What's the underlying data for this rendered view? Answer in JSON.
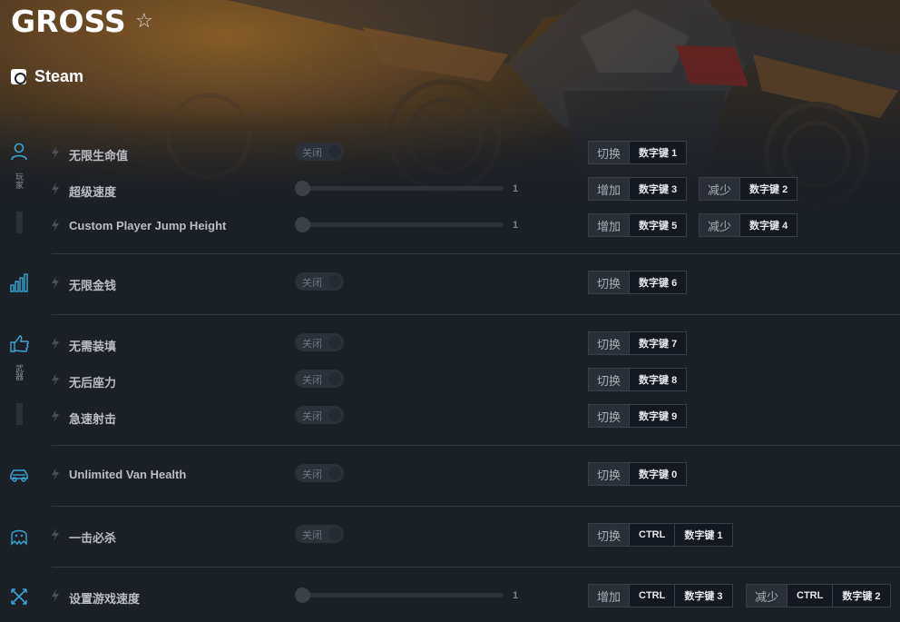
{
  "game": {
    "title": "GROSS",
    "platform": "Steam"
  },
  "categories": [
    {
      "name": "player",
      "label": "玩家"
    },
    {
      "name": "stats",
      "label": ""
    },
    {
      "name": "weapons",
      "label": "武器"
    },
    {
      "name": "vehicle",
      "label": ""
    },
    {
      "name": "enemy",
      "label": ""
    },
    {
      "name": "game",
      "label": ""
    }
  ],
  "options": [
    {
      "name": "无限生命值",
      "control": "toggle",
      "state": "关闭",
      "hotkeys": [
        {
          "action": "切换",
          "keys": [
            "数字键 1"
          ]
        }
      ]
    },
    {
      "name": "超级速度",
      "control": "slider",
      "value": "1",
      "hotkeys": [
        {
          "action": "增加",
          "keys": [
            "数字键 3"
          ]
        },
        {
          "action": "减少",
          "keys": [
            "数字键 2"
          ]
        }
      ]
    },
    {
      "name": "Custom Player Jump Height",
      "control": "slider",
      "value": "1",
      "hotkeys": [
        {
          "action": "增加",
          "keys": [
            "数字键 5"
          ]
        },
        {
          "action": "减少",
          "keys": [
            "数字键 4"
          ]
        }
      ]
    },
    {
      "name": "无限金钱",
      "control": "toggle",
      "state": "关闭",
      "hotkeys": [
        {
          "action": "切换",
          "keys": [
            "数字键 6"
          ]
        }
      ]
    },
    {
      "name": "无需装填",
      "control": "toggle",
      "state": "关闭",
      "hotkeys": [
        {
          "action": "切换",
          "keys": [
            "数字键 7"
          ]
        }
      ]
    },
    {
      "name": "无后座力",
      "control": "toggle",
      "state": "关闭",
      "hotkeys": [
        {
          "action": "切换",
          "keys": [
            "数字键 8"
          ]
        }
      ]
    },
    {
      "name": "急速射击",
      "control": "toggle",
      "state": "关闭",
      "hotkeys": [
        {
          "action": "切换",
          "keys": [
            "数字键 9"
          ]
        }
      ]
    },
    {
      "name": "Unlimited Van Health",
      "control": "toggle",
      "state": "关闭",
      "hotkeys": [
        {
          "action": "切换",
          "keys": [
            "数字键 0"
          ]
        }
      ]
    },
    {
      "name": "一击必杀",
      "control": "toggle",
      "state": "关闭",
      "hotkeys": [
        {
          "action": "切换",
          "keys": [
            "CTRL",
            "数字键 1"
          ]
        }
      ]
    },
    {
      "name": "设置游戏速度",
      "control": "slider",
      "value": "1",
      "hotkeys": [
        {
          "action": "增加",
          "keys": [
            "CTRL",
            "数字键 3"
          ]
        },
        {
          "action": "减少",
          "keys": [
            "CTRL",
            "数字键 2"
          ]
        }
      ]
    }
  ],
  "colors": {
    "background": "#1b1f26",
    "accent": "#3aa6d8",
    "title": "#ffffff"
  }
}
